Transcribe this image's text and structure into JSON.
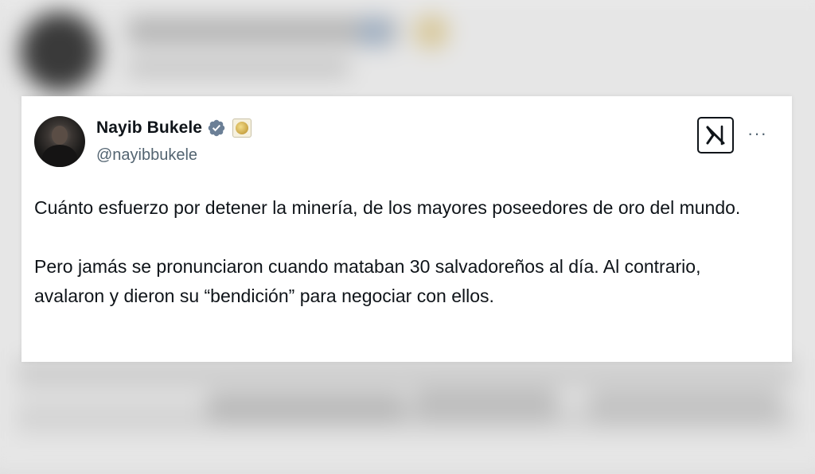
{
  "tweet": {
    "author_name": "Nayib Bukele",
    "handle": "@nayibbukele",
    "paragraphs": [
      "Cuánto esfuerzo por detener la minería, de los mayores poseedores de oro del mundo.",
      "Pero jamás se pronunciaron cuando mataban 30 salvadoreños al día. Al contrario, avalaron y dieron su “bendición” para negociar con ellos."
    ],
    "more_label": "···"
  },
  "icons": {
    "verified": "verified-badge-icon",
    "affiliation": "gold-seal-icon",
    "platform": "x-logo-icon"
  },
  "colors": {
    "verified_badge": "#6b7f96",
    "text": "#0f1419",
    "handle": "#536471"
  }
}
